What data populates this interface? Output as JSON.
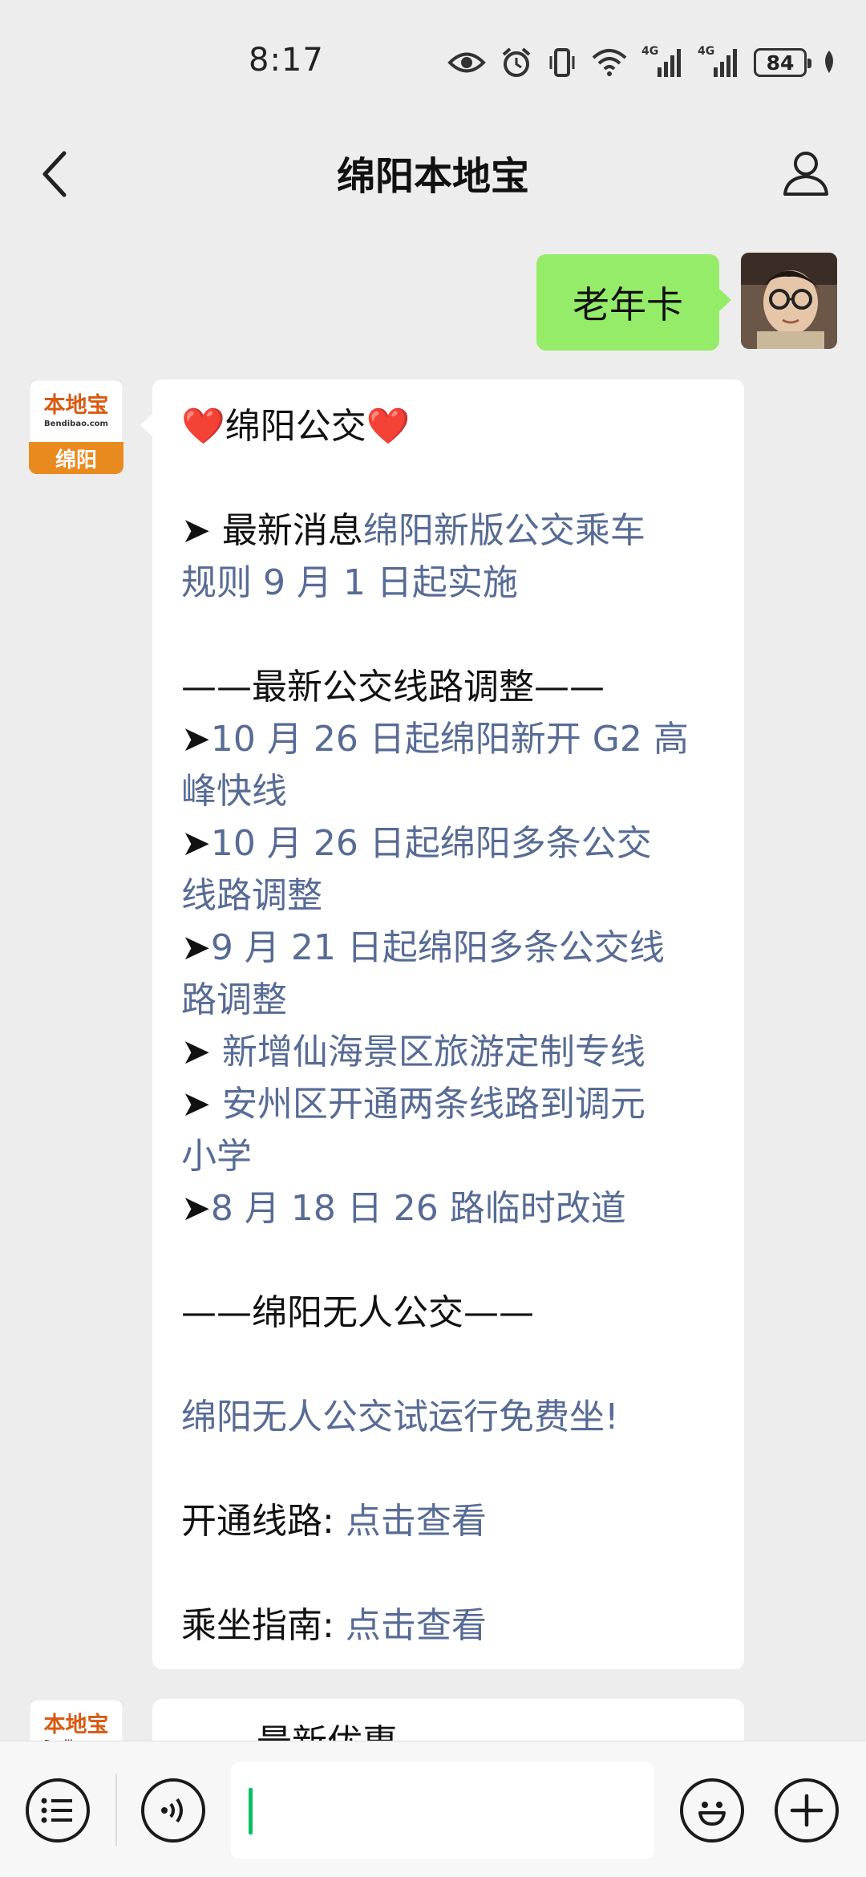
{
  "status_bar": {
    "time": "8:17",
    "network_1": "4G",
    "network_2": "4G",
    "battery": "84",
    "icons": [
      "eye-icon",
      "alarm-icon",
      "vibrate-icon",
      "wifi-icon",
      "signal-icon",
      "signal-icon",
      "battery-icon",
      "leaf-icon"
    ]
  },
  "nav": {
    "title": "绵阳本地宝",
    "icons": [
      "chevron-left-icon",
      "person-icon"
    ]
  },
  "chat": {
    "sent_text": "老年卡",
    "official_avatar": {
      "brand": "本地宝",
      "brand_sub": "Bendibao.com",
      "city": "绵阳"
    },
    "message": {
      "heart_left": "❤️",
      "title": "绵阳公交",
      "heart_right": "❤️",
      "news_prefix": "➤ 最新消息",
      "news_link_1": "绵阳新版公交乘车",
      "news_link_2": "规则 9 月 1 日起实施",
      "section_1": "——最新公交线路调整——",
      "arrow": "➤",
      "arrow_spaced": "➤ ",
      "route_1a": "10 月 26 日起绵阳新开 G2 高",
      "route_1b": "峰快线",
      "route_2a": "10 月 26 日起绵阳多条公交",
      "route_2b": "线路调整",
      "route_3a": "9 月 21 日起绵阳多条公交线",
      "route_3b": "路调整",
      "route_4": "新增仙海景区旅游定制专线",
      "route_5a": "安州区开通两条线路到调元",
      "route_5b": "小学",
      "route_6": "8 月 18 日 26 路临时改道",
      "section_2": "——绵阳无人公交——",
      "driverless": "绵阳无人公交试运行免费坐!",
      "open_routes_label": "开通线路:",
      "open_routes_link": "点击查看",
      "guide_label": "乘坐指南:",
      "guide_link": "点击查看"
    },
    "next_message_partial": "最新优惠"
  },
  "input_bar": {
    "icons": [
      "menu-list-icon",
      "voice-icon",
      "emoji-icon",
      "plus-icon"
    ]
  },
  "colors": {
    "bubble_sent": "#95ec69",
    "link": "#576b95",
    "caret": "#07c160",
    "background": "#ededed"
  }
}
